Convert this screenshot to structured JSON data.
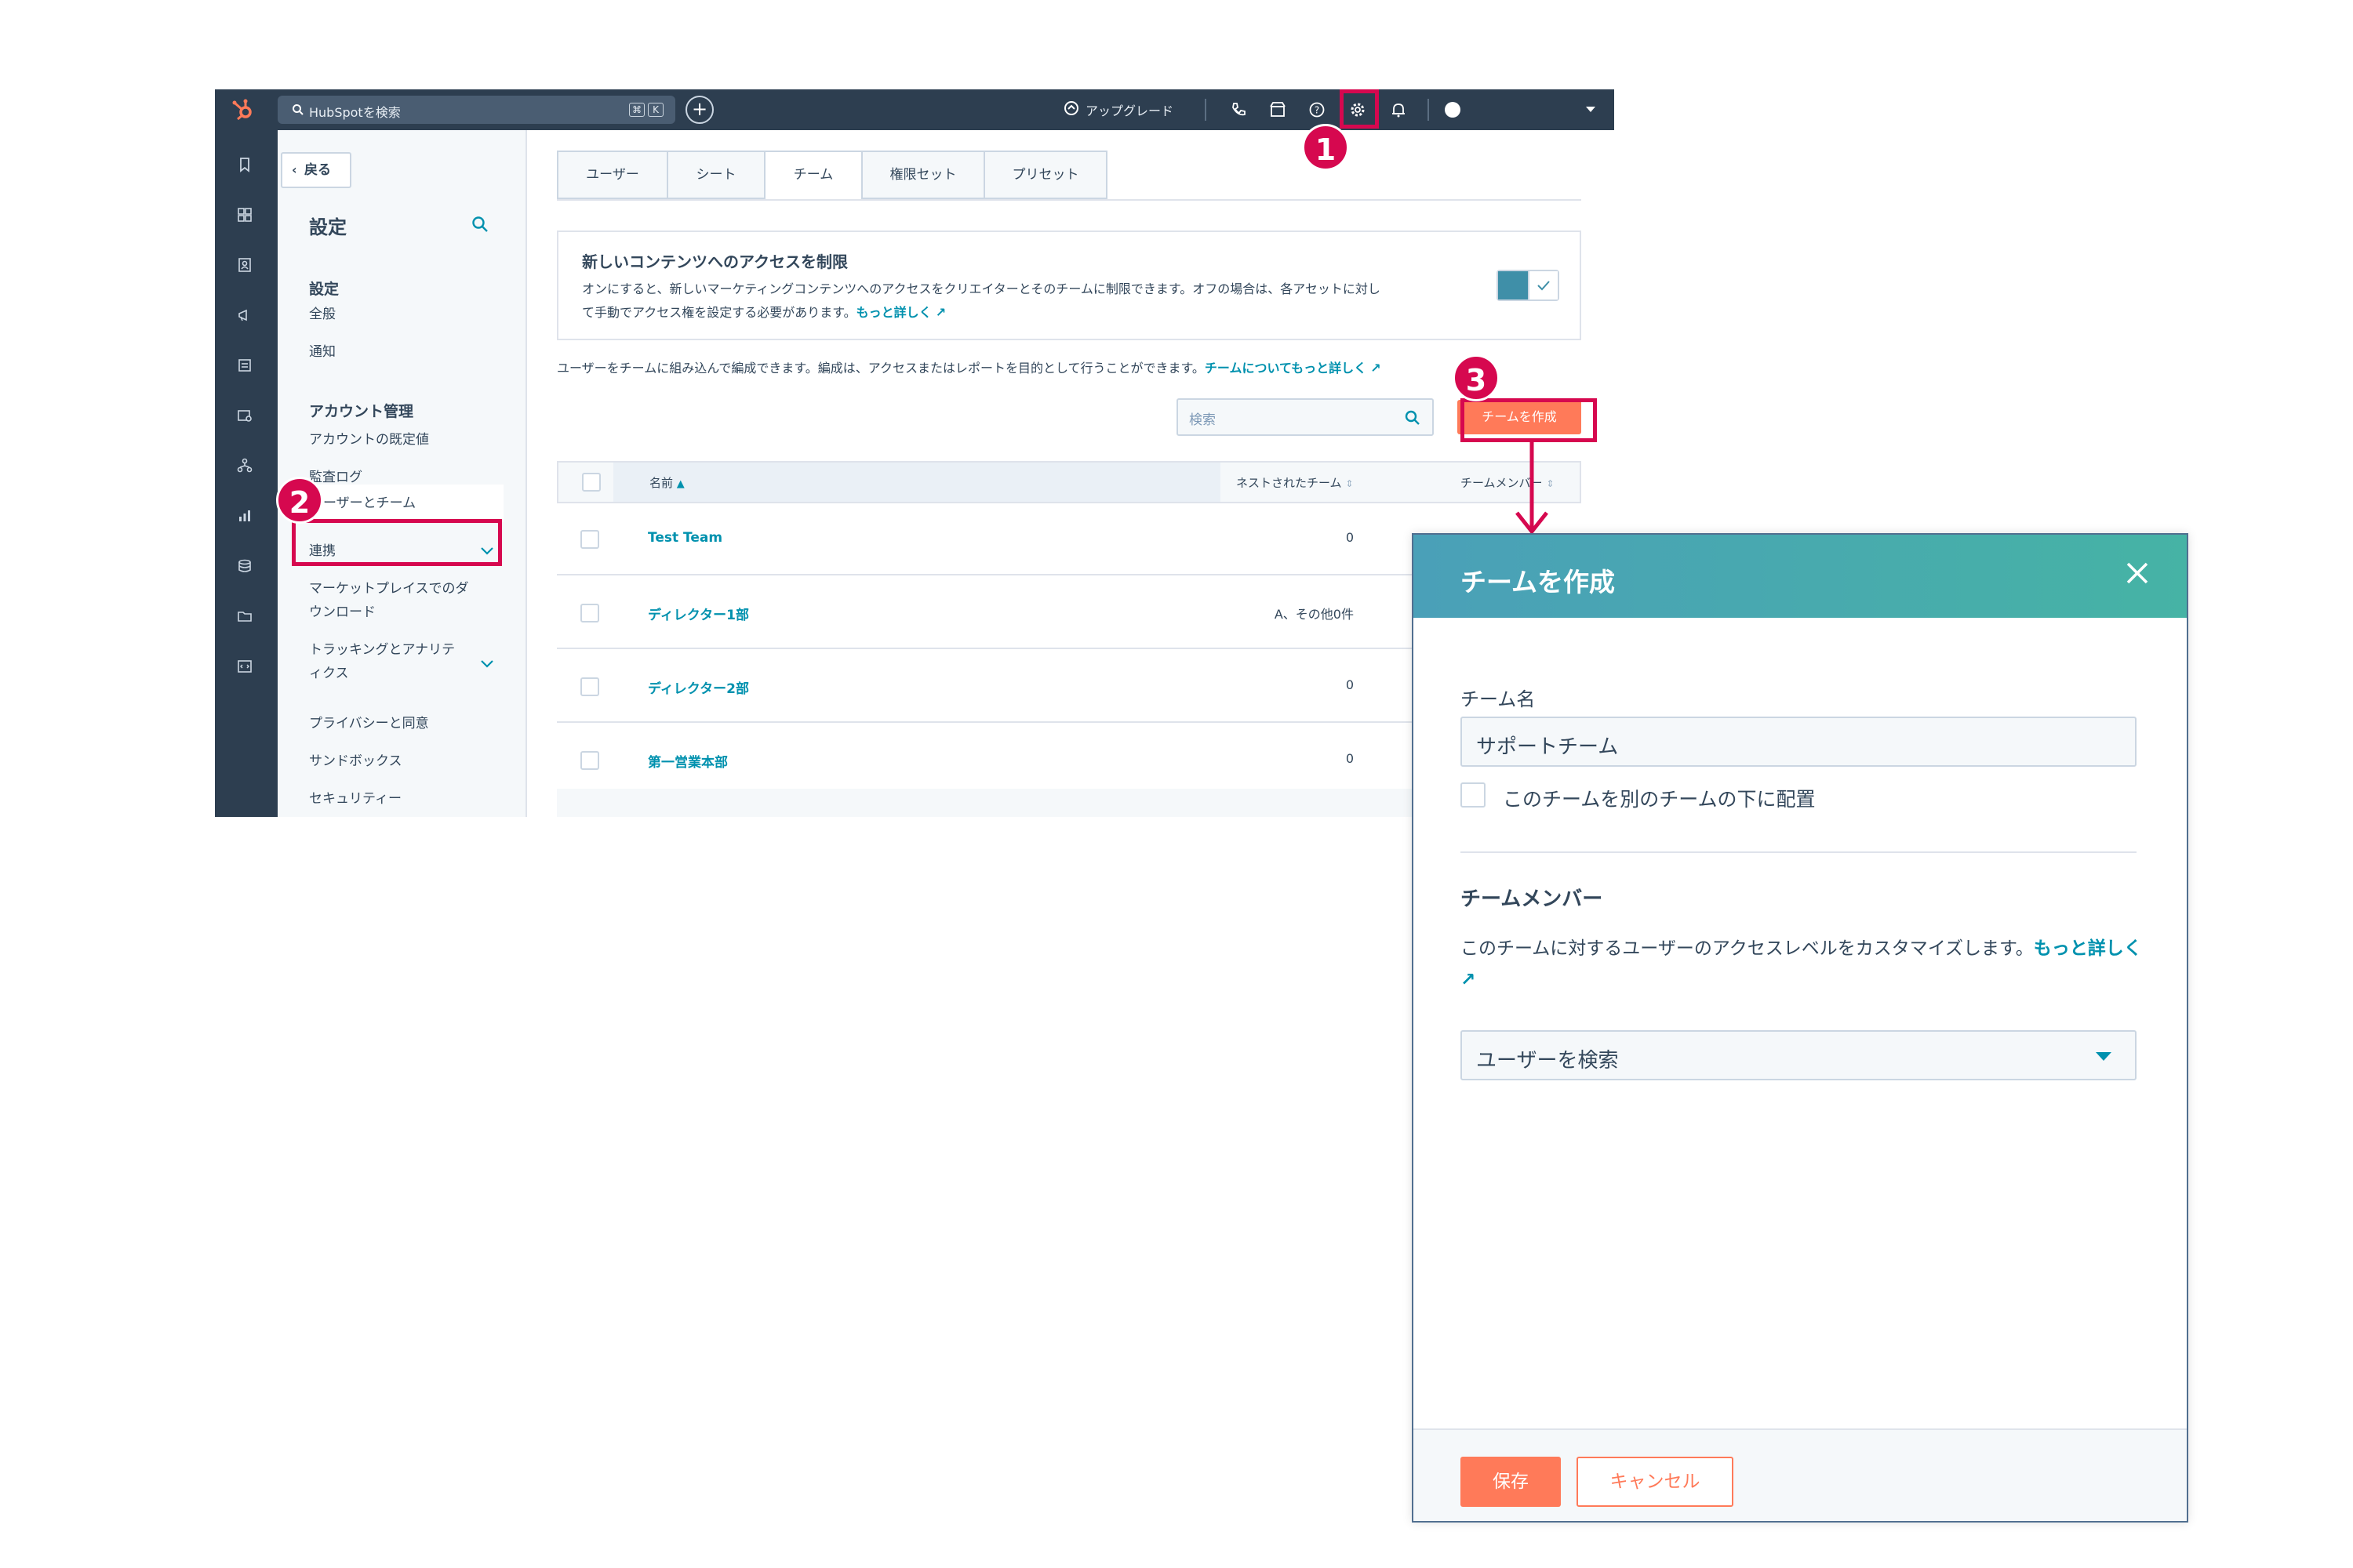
{
  "topbar": {
    "search_placeholder": "HubSpotを検索",
    "kbd1": "⌘",
    "kbd2": "K",
    "plus": "+",
    "upgrade": "アップグレード"
  },
  "nav": {
    "back": "戻る",
    "title": "設定",
    "section1": "設定",
    "general": "全般",
    "notifications": "通知",
    "section2": "アカウント管理",
    "account_defaults": "アカウントの既定値",
    "audit_log": "監査ログ",
    "users_teams": "ユーザーとチーム",
    "integrations": "連携",
    "marketplace_1": "マーケットプレイスでのダ",
    "marketplace_2": "ウンロード",
    "tracking_1": "トラッキングとアナリテ",
    "tracking_2": "ィクス",
    "privacy": "プライバシーと同意",
    "sandbox": "サンドボックス",
    "security": "セキュリティー"
  },
  "tabs": [
    "ユーザー",
    "シート",
    "チーム",
    "権限セット",
    "プリセット"
  ],
  "notice": {
    "title": "新しいコンテンツへのアクセスを制限",
    "text_1": "オンにすると、新しいマーケティングコンテンツへのアクセスをクリエイターとそのチームに制限できます。オフの場合は、各アセットに対し",
    "text_2": "て手動でアクセス権を設定する必要があります。",
    "link": "もっと詳しく"
  },
  "description": {
    "text": "ユーザーをチームに組み込んで編成できます。編成は、アクセスまたはレポートを目的として行うことができます。",
    "link": "チームについてもっと詳しく"
  },
  "table": {
    "search_placeholder": "検索",
    "create_button": "チームを作成",
    "headers": {
      "name": "名前",
      "nested": "ネストされたチーム",
      "members": "チームメンバー"
    },
    "rows": [
      {
        "name": "Test Team",
        "nested": "0"
      },
      {
        "name": "ディレクター1部",
        "nested": "A、その他0件"
      },
      {
        "name": "ディレクター2部",
        "nested": "0"
      },
      {
        "name": "第一営業本部",
        "nested": "0"
      }
    ]
  },
  "annotations": {
    "step1": "1",
    "step2": "2",
    "step3": "3"
  },
  "panel": {
    "title": "チームを作成",
    "team_name_label": "チーム名",
    "team_name_value": "サポートチーム",
    "place_under_label": "このチームを別のチームの下に配置",
    "members_title": "チームメンバー",
    "members_text": "このチームに対するユーザーのアクセスレベルをカスタマイズします。",
    "members_link": "もっと詳しく",
    "user_search": "ユーザーを検索",
    "save": "保存",
    "cancel": "キャンセル"
  },
  "colors": {
    "accent": "#ff7a59",
    "highlight": "#d6084f",
    "link": "#0091ae",
    "topbar": "#2d3e50"
  }
}
